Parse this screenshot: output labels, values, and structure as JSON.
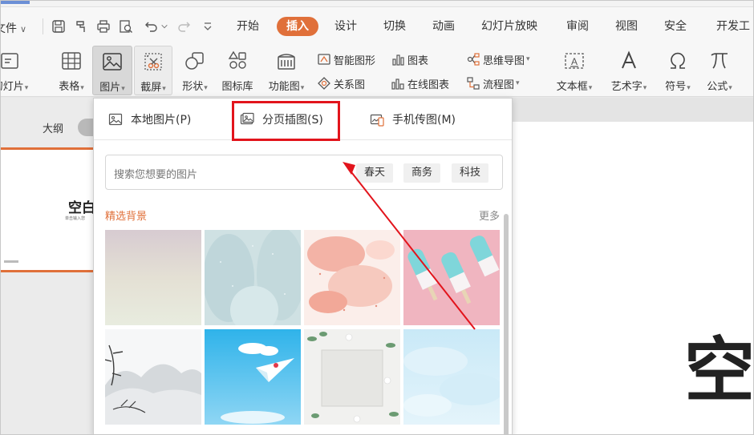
{
  "menu": {
    "file_label": "文件",
    "tabs": [
      {
        "label": "开始"
      },
      {
        "label": "插入",
        "active": true
      },
      {
        "label": "设计"
      },
      {
        "label": "切换"
      },
      {
        "label": "动画"
      },
      {
        "label": "幻灯片放映"
      },
      {
        "label": "审阅"
      },
      {
        "label": "视图"
      },
      {
        "label": "安全"
      },
      {
        "label": "开发工"
      }
    ]
  },
  "ribbon": {
    "new_slide": "幻灯片",
    "table": "表格",
    "picture": "图片",
    "screenshot": "截屏",
    "shape": "形状",
    "icon_lib": "图标库",
    "func_chart": "功能图",
    "smart_graphic": "智能图形",
    "chart": "图表",
    "relation": "关系图",
    "online_chart": "在线图表",
    "mindmap": "思维导图",
    "flowchart": "流程图",
    "textbox": "文本框",
    "wordart": "艺术字",
    "symbol": "符号",
    "formula": "公式"
  },
  "left_panel": {
    "outline_label": "大纲",
    "thumb_title": "空白",
    "thumb_sub": "单击输入您"
  },
  "popup": {
    "tabs": {
      "local": "本地图片(P)",
      "paged": "分页插图(S)",
      "phone": "手机传图(M)"
    },
    "search_placeholder": "搜索您想要的图片",
    "chips": [
      "春天",
      "商务",
      "科技"
    ],
    "section_title": "精选背景",
    "more_label": "更多"
  },
  "slide": {
    "big_text": "空"
  },
  "colors": {
    "accent": "#e0703a",
    "highlight": "#e2141c"
  }
}
